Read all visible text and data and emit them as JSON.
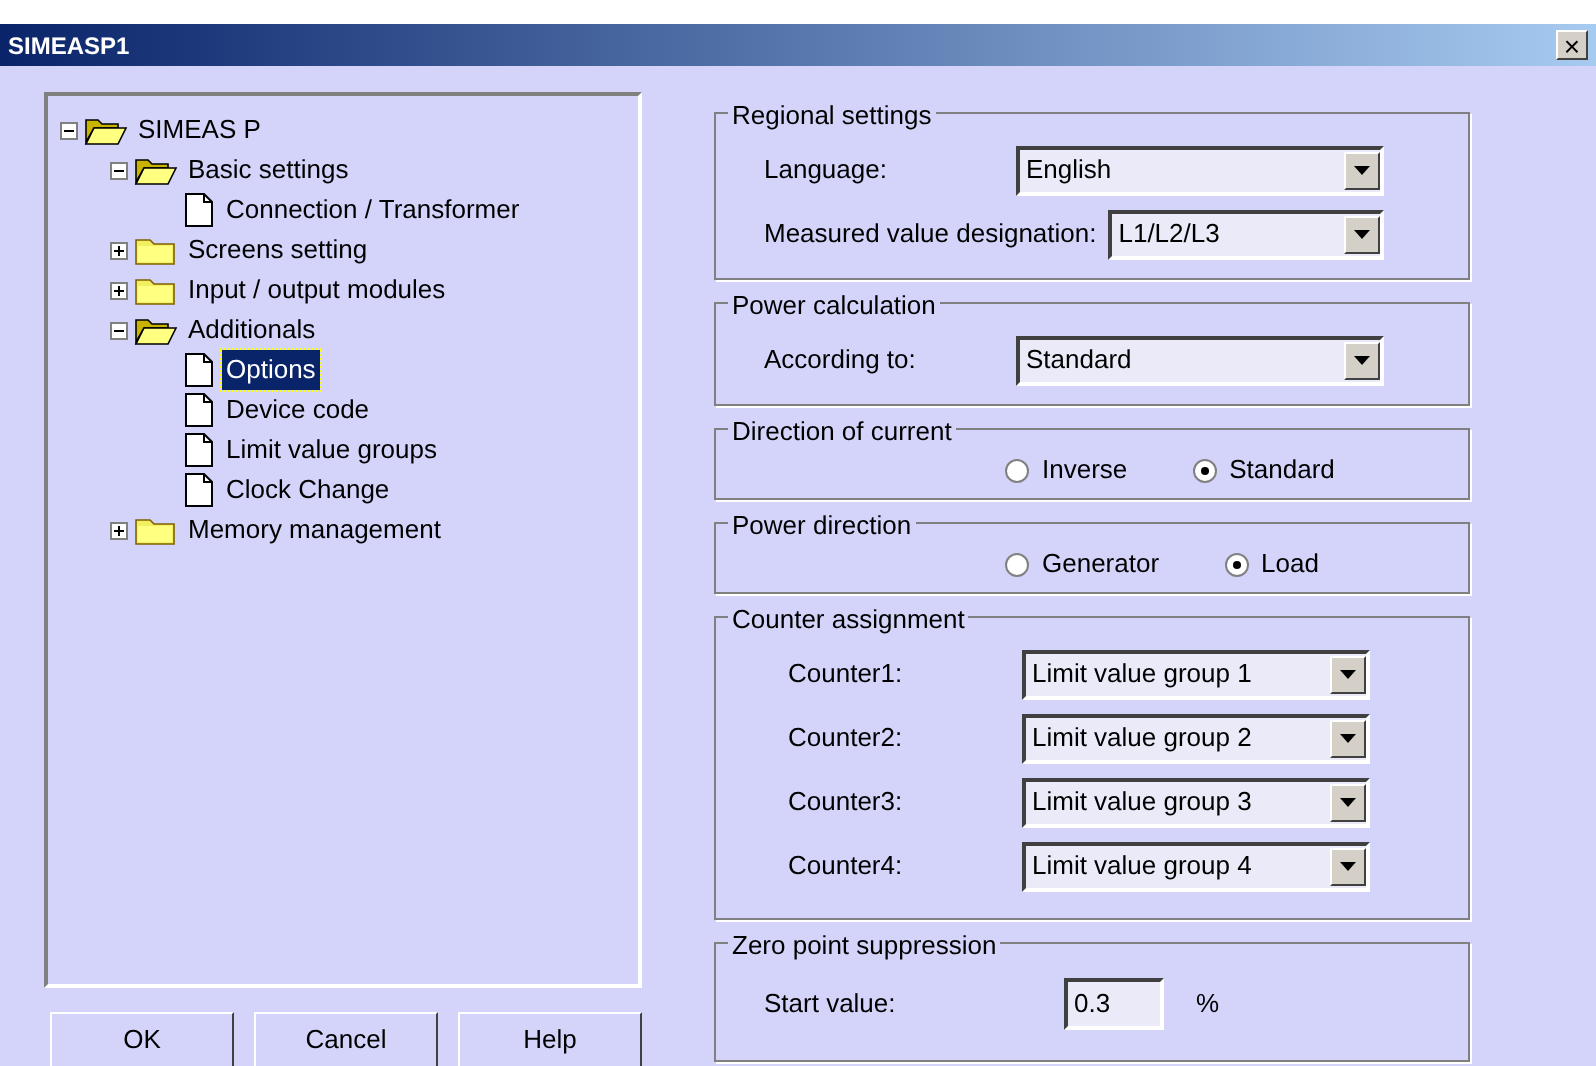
{
  "window": {
    "title": "SIMEASP1",
    "close": "×"
  },
  "tree": [
    {
      "label": "SIMEAS P",
      "kind": "folder",
      "expanded": true,
      "selected": false,
      "children": [
        {
          "label": "Basic settings",
          "kind": "folder",
          "expanded": true,
          "selected": false,
          "children": [
            {
              "label": "Connection / Transformer",
              "kind": "page",
              "selected": false
            }
          ]
        },
        {
          "label": "Screens setting",
          "kind": "folder",
          "expanded": false,
          "selected": false
        },
        {
          "label": "Input / output modules",
          "kind": "folder",
          "expanded": false,
          "selected": false
        },
        {
          "label": "Additionals",
          "kind": "folder",
          "expanded": true,
          "selected": false,
          "children": [
            {
              "label": "Options",
              "kind": "page",
              "selected": true
            },
            {
              "label": "Device code",
              "kind": "page",
              "selected": false
            },
            {
              "label": "Limit value groups",
              "kind": "page",
              "selected": false
            },
            {
              "label": "Clock Change",
              "kind": "page",
              "selected": false
            }
          ]
        },
        {
          "label": "Memory management",
          "kind": "folder",
          "expanded": false,
          "selected": false
        }
      ]
    }
  ],
  "groups": [
    {
      "title": "Regional settings",
      "kind": "fields",
      "fields": [
        {
          "label": "Language:",
          "value": "English"
        },
        {
          "label": "Measured value designation:",
          "value": "L1/L2/L3"
        }
      ]
    },
    {
      "title": "Power calculation",
      "kind": "fields",
      "fields": [
        {
          "label": "According to:",
          "value": "Standard"
        }
      ]
    },
    {
      "title": "Direction of current",
      "kind": "radios",
      "options": [
        {
          "label": "Inverse",
          "selected": false
        },
        {
          "label": "Standard",
          "selected": true
        }
      ]
    },
    {
      "title": "Power direction",
      "kind": "radios",
      "options": [
        {
          "label": "Generator",
          "selected": false
        },
        {
          "label": "Load",
          "selected": true
        }
      ]
    },
    {
      "title": "Counter assignment",
      "kind": "counters",
      "fields": [
        {
          "label": "Counter1:",
          "value": "Limit value group 1"
        },
        {
          "label": "Counter2:",
          "value": "Limit value group 2"
        },
        {
          "label": "Counter3:",
          "value": "Limit value group 3"
        },
        {
          "label": "Counter4:",
          "value": "Limit value group 4"
        }
      ]
    },
    {
      "title": "Zero point suppression",
      "kind": "value",
      "label": "Start value:",
      "value": "0.3",
      "unit": "%"
    }
  ],
  "buttons": [
    "OK",
    "Cancel",
    "Help"
  ]
}
